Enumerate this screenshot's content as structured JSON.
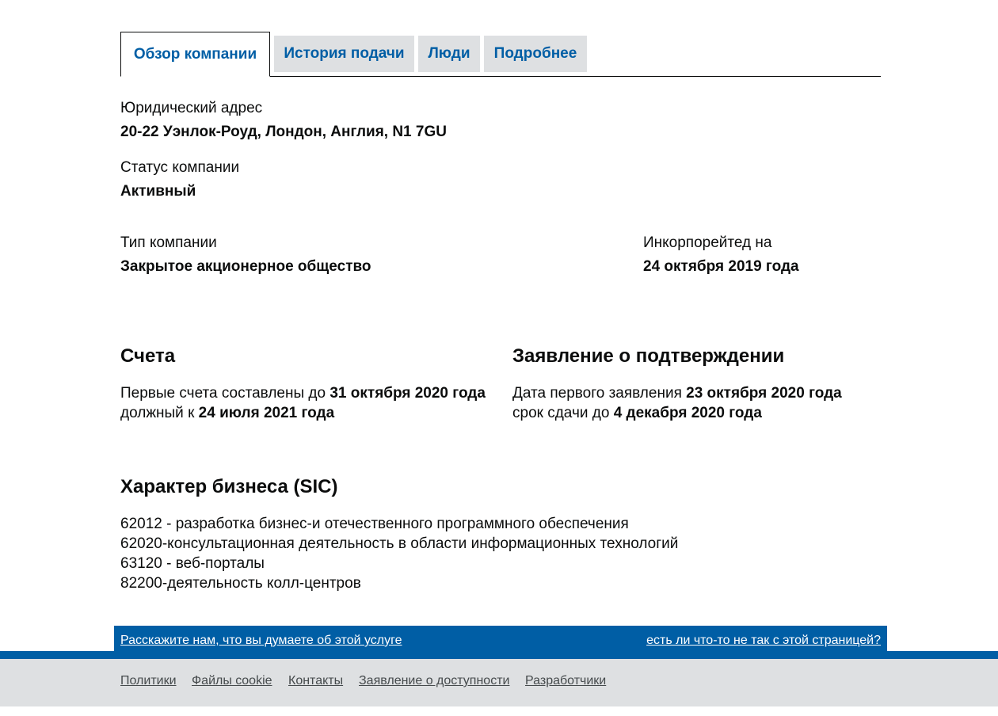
{
  "tabs": [
    {
      "label": "Обзор компании",
      "active": true
    },
    {
      "label": "История подачи",
      "active": false
    },
    {
      "label": "Люди",
      "active": false
    },
    {
      "label": "Подробнее",
      "active": false
    }
  ],
  "overview": {
    "registered_address_label": "Юридический адрес",
    "registered_address_value": "20-22 Уэнлок-Роуд, Лондон, Англия, N1 7GU",
    "status_label": "Статус компании",
    "status_value": "Активный",
    "type_label": "Тип компании",
    "type_value": "Закрытое акционерное общество",
    "incorporated_label": "Инкорпорейтед на",
    "incorporated_value": "24 октября 2019 года"
  },
  "accounts": {
    "heading": "Счета",
    "line1_prefix": "Первые счета составлены до ",
    "line1_date": "31 октября 2020 года",
    "line2_prefix": "должный к ",
    "line2_date": "24 июля 2021 года"
  },
  "confirmation": {
    "heading": "Заявление о подтверждении",
    "line1_prefix": "Дата первого заявления ",
    "line1_date": "23 октября 2020 года",
    "line2_prefix": "срок сдачи до ",
    "line2_date": "4 декабря 2020 года"
  },
  "sic": {
    "heading": "Характер бизнеса (SIC)",
    "items": [
      "62012 - разработка бизнес-и отечественного программного обеспечения",
      "62020-консультационная деятельность в области информационных технологий",
      "63120 - веб-порталы",
      "82200-деятельность колл-центров"
    ]
  },
  "feedback": {
    "left_link": "Расскажите нам, что вы думаете об этой услуге",
    "right_link": "есть ли что-то не так с этой страницей?"
  },
  "footer": {
    "links": [
      "Политики",
      "Файлы cookie",
      "Контакты",
      "Заявление о доступности",
      "Разработчики"
    ]
  },
  "colors": {
    "link_blue": "#005ea5",
    "tab_grey": "#dee0e2",
    "text": "#0b0c0c",
    "footer_text": "#454a4c"
  }
}
